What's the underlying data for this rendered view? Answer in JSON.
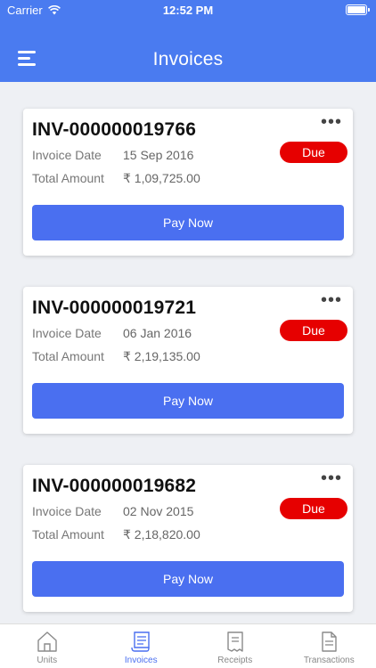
{
  "status_bar": {
    "carrier": "Carrier",
    "time": "12:52 PM"
  },
  "header": {
    "title": "Invoices"
  },
  "invoices": [
    {
      "number": "INV-000000019766",
      "status": "Due",
      "date_label": "Invoice Date",
      "date": "15 Sep 2016",
      "amount_label": "Total Amount",
      "amount": "₹ 1,09,725.00",
      "action": "Pay Now"
    },
    {
      "number": "INV-000000019721",
      "status": "Due",
      "date_label": "Invoice Date",
      "date": "06 Jan 2016",
      "amount_label": "Total Amount",
      "amount": "₹ 2,19,135.00",
      "action": "Pay Now"
    },
    {
      "number": "INV-000000019682",
      "status": "Due",
      "date_label": "Invoice Date",
      "date": "02 Nov 2015",
      "amount_label": "Total Amount",
      "amount": "₹ 2,18,820.00",
      "action": "Pay Now"
    }
  ],
  "tabs": [
    {
      "label": "Units",
      "icon": "home-icon"
    },
    {
      "label": "Invoices",
      "icon": "invoice-icon",
      "active": true
    },
    {
      "label": "Receipts",
      "icon": "receipt-icon"
    },
    {
      "label": "Transactions",
      "icon": "document-icon"
    }
  ],
  "colors": {
    "primary": "#4a7bf0",
    "button": "#4a6ff0",
    "due_badge": "#e60000",
    "background": "#eef0f4"
  }
}
